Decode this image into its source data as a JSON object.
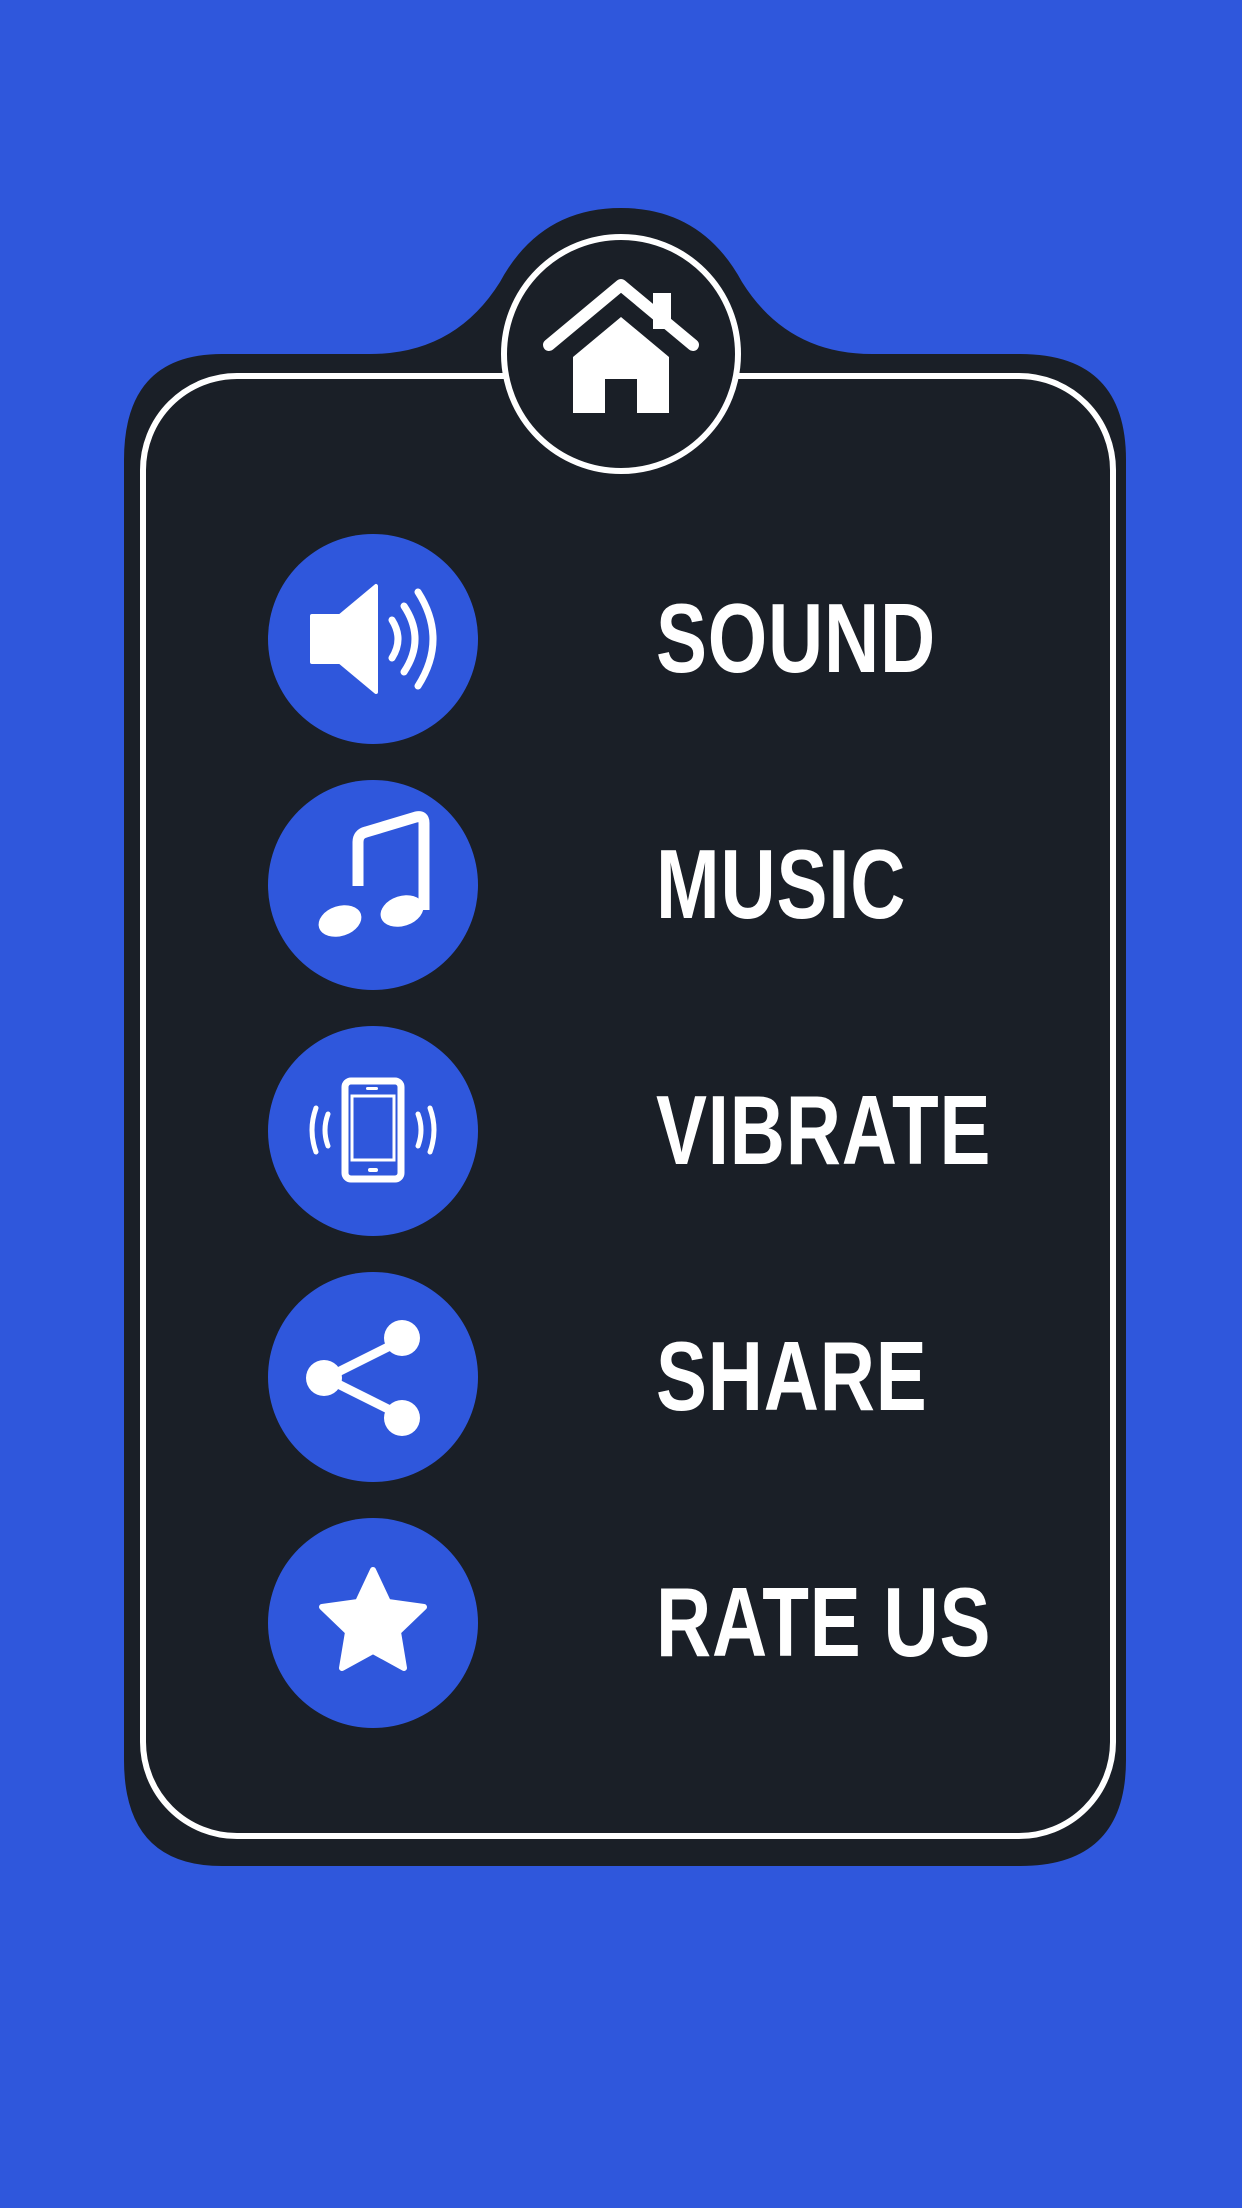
{
  "colors": {
    "background": "#2f57dc",
    "panel": "#1a1f27",
    "outline": "#ffffff",
    "icon_circle": "#2f57dc",
    "label": "#ffffff"
  },
  "header": {
    "icon": "home-icon"
  },
  "menu": {
    "items": [
      {
        "label": "SOUND",
        "icon": "speaker-icon"
      },
      {
        "label": "MUSIC",
        "icon": "music-note-icon"
      },
      {
        "label": "VIBRATE",
        "icon": "vibrate-phone-icon"
      },
      {
        "label": "SHARE",
        "icon": "share-icon"
      },
      {
        "label": "RATE US",
        "icon": "star-icon"
      }
    ]
  }
}
